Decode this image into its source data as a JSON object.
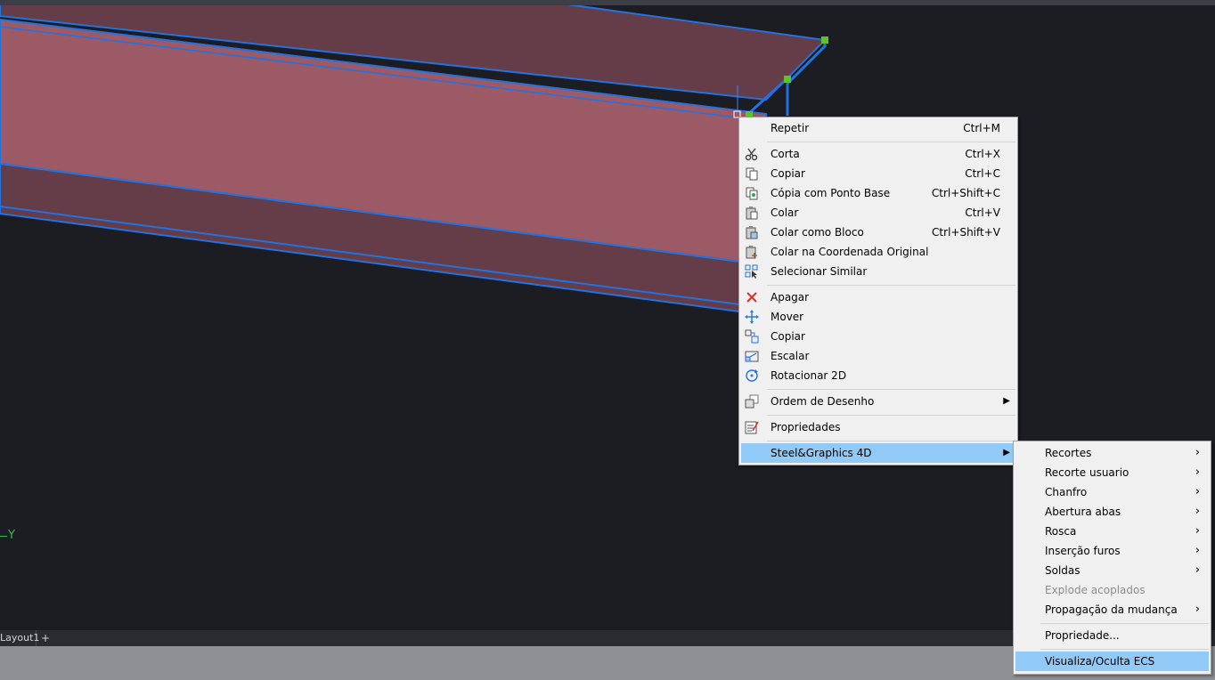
{
  "context_menu": {
    "items": [
      {
        "label": "Repetir",
        "shortcut": "Ctrl+M"
      },
      {
        "label": "Corta",
        "shortcut": "Ctrl+X"
      },
      {
        "label": "Copiar",
        "shortcut": "Ctrl+C"
      },
      {
        "label": "Cópia com Ponto Base",
        "shortcut": "Ctrl+Shift+C"
      },
      {
        "label": "Colar",
        "shortcut": "Ctrl+V"
      },
      {
        "label": "Colar como Bloco",
        "shortcut": "Ctrl+Shift+V"
      },
      {
        "label": "Colar na Coordenada Original",
        "shortcut": ""
      },
      {
        "label": "Selecionar Similar",
        "shortcut": ""
      },
      {
        "label": "Apagar",
        "shortcut": ""
      },
      {
        "label": "Mover",
        "shortcut": ""
      },
      {
        "label": "Copiar",
        "shortcut": ""
      },
      {
        "label": "Escalar",
        "shortcut": ""
      },
      {
        "label": "Rotacionar 2D",
        "shortcut": ""
      },
      {
        "label": "Ordem de Desenho",
        "shortcut": ""
      },
      {
        "label": "Propriedades",
        "shortcut": ""
      },
      {
        "label": "Steel&Graphics 4D",
        "shortcut": ""
      }
    ]
  },
  "sub_menu": {
    "items": [
      {
        "label": "Recortes"
      },
      {
        "label": "Recorte usuario"
      },
      {
        "label": "Chanfro"
      },
      {
        "label": "Abertura abas"
      },
      {
        "label": "Rosca"
      },
      {
        "label": "Inserção furos"
      },
      {
        "label": "Soldas"
      },
      {
        "label": "Explode acoplados"
      },
      {
        "label": "Propagação da mudança"
      },
      {
        "label": "Propriedade..."
      },
      {
        "label": "Visualiza/Oculta ECS"
      }
    ]
  },
  "tabs": {
    "layout1": "Layout1",
    "add": "+"
  },
  "ucs": {
    "y_label": "Y"
  },
  "icons": {
    "corta": "scissors-icon",
    "copiar": "copy-icon",
    "copia_base": "copy-base-point-icon",
    "colar": "paste-icon",
    "colar_bloco": "paste-block-icon",
    "colar_original": "paste-original-icon",
    "selecionar_similar": "select-similar-icon",
    "apagar": "erase-icon",
    "mover": "move-icon",
    "copiar2": "copy-object-icon",
    "escalar": "scale-icon",
    "rotacionar": "rotate-icon",
    "ordem": "draw-order-icon",
    "propriedades": "properties-icon"
  },
  "colors": {
    "canvas": "#1b1d22",
    "beam_face": "#9b5a65",
    "beam_dark": "#643d48",
    "beam_edge": "#2272e0",
    "grip": "#5ec22a",
    "menu_bg": "#f0f0f0",
    "highlight": "#91c9f7"
  }
}
